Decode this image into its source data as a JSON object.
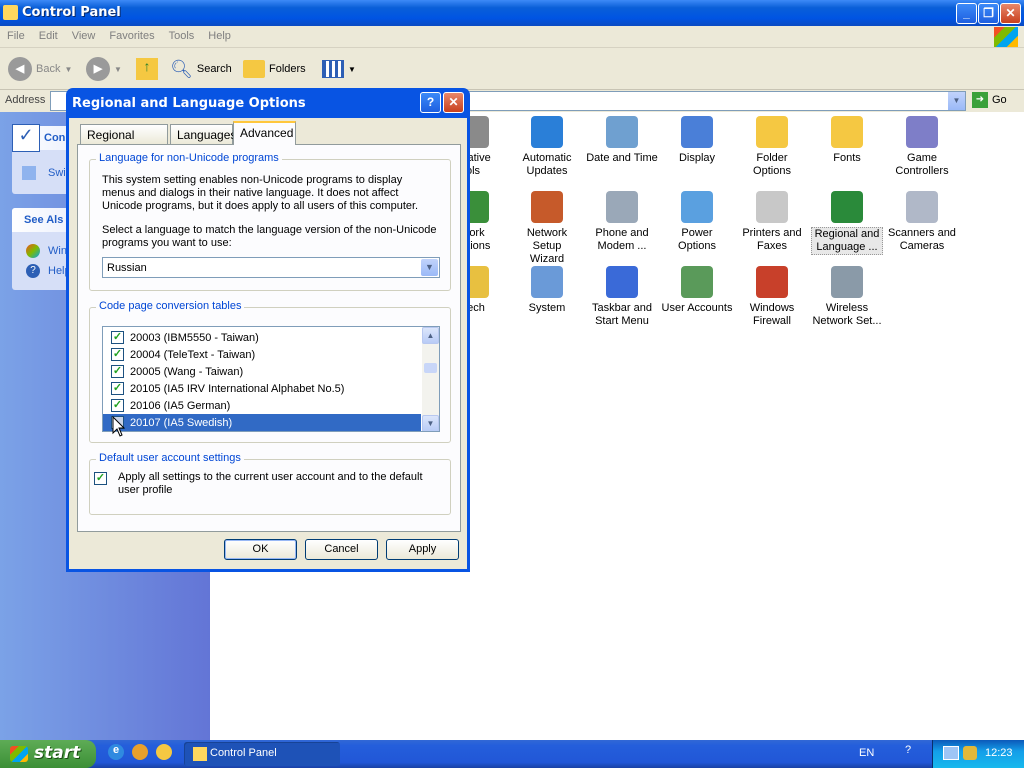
{
  "window": {
    "title": "Control Panel"
  },
  "menu": [
    "File",
    "Edit",
    "View",
    "Favorites",
    "Tools",
    "Help"
  ],
  "toolbar": {
    "back": "Back",
    "search": "Search",
    "folders": "Folders"
  },
  "address": {
    "label": "Address",
    "go": "Go"
  },
  "leftpane": {
    "panel_title": "Con",
    "switch_label": "Swi",
    "see_also": "See Als",
    "link1": "Win",
    "link2": "Help"
  },
  "icons": [
    {
      "label": "strative\nols",
      "name": "administrative-tools-icon"
    },
    {
      "label": "Automatic\nUpdates",
      "name": "automatic-updates-icon"
    },
    {
      "label": "Date and Time",
      "name": "date-time-icon"
    },
    {
      "label": "Display",
      "name": "display-icon"
    },
    {
      "label": "Folder Options",
      "name": "folder-options-icon"
    },
    {
      "label": "Fonts",
      "name": "fonts-icon"
    },
    {
      "label": "Game\nControllers",
      "name": "game-controllers-icon"
    },
    {
      "label": "work\nections",
      "name": "network-connections-icon"
    },
    {
      "label": "Network Setup\nWizard",
      "name": "network-setup-icon"
    },
    {
      "label": "Phone and\nModem ...",
      "name": "phone-modem-icon"
    },
    {
      "label": "Power Options",
      "name": "power-options-icon"
    },
    {
      "label": "Printers and\nFaxes",
      "name": "printers-faxes-icon"
    },
    {
      "label": "Regional and\nLanguage ...",
      "name": "regional-language-icon"
    },
    {
      "label": "Scanners and\nCameras",
      "name": "scanners-cameras-icon"
    },
    {
      "label": "eech",
      "name": "speech-icon"
    },
    {
      "label": "System",
      "name": "system-icon"
    },
    {
      "label": "Taskbar and\nStart Menu",
      "name": "taskbar-startmenu-icon"
    },
    {
      "label": "User Accounts",
      "name": "user-accounts-icon"
    },
    {
      "label": "Windows\nFirewall",
      "name": "windows-firewall-icon"
    },
    {
      "label": "Wireless\nNetwork Set...",
      "name": "wireless-network-icon"
    }
  ],
  "dialog": {
    "title": "Regional and Language Options",
    "tabs": [
      "Regional Options",
      "Languages",
      "Advanced"
    ],
    "nonunicode": {
      "group_label": "Language for non-Unicode programs",
      "desc": "This system setting enables non-Unicode programs to display menus and dialogs in their native language. It does not affect Unicode programs, but it does apply to all users of this computer.",
      "prompt": "Select a language to match the language version of the non-Unicode programs you want to use:",
      "selected": "Russian"
    },
    "codepage": {
      "group_label": "Code page conversion tables",
      "items": [
        {
          "label": "20003 (IBM5550 - Taiwan)",
          "checked": true
        },
        {
          "label": "20004 (TeleText - Taiwan)",
          "checked": true
        },
        {
          "label": "20005 (Wang - Taiwan)",
          "checked": true
        },
        {
          "label": "20105 (IA5 IRV International Alphabet No.5)",
          "checked": true
        },
        {
          "label": "20106 (IA5 German)",
          "checked": true
        },
        {
          "label": "20107 (IA5 Swedish)",
          "checked": false,
          "selected": true
        }
      ]
    },
    "defaults": {
      "group_label": "Default user account settings",
      "checkbox": "Apply all settings to the current user account and to the default user profile"
    },
    "ok": "OK",
    "cancel": "Cancel",
    "apply": "Apply"
  },
  "taskbar": {
    "start": "start",
    "task": "Control Panel",
    "lang": "EN",
    "clock": "12:23"
  }
}
